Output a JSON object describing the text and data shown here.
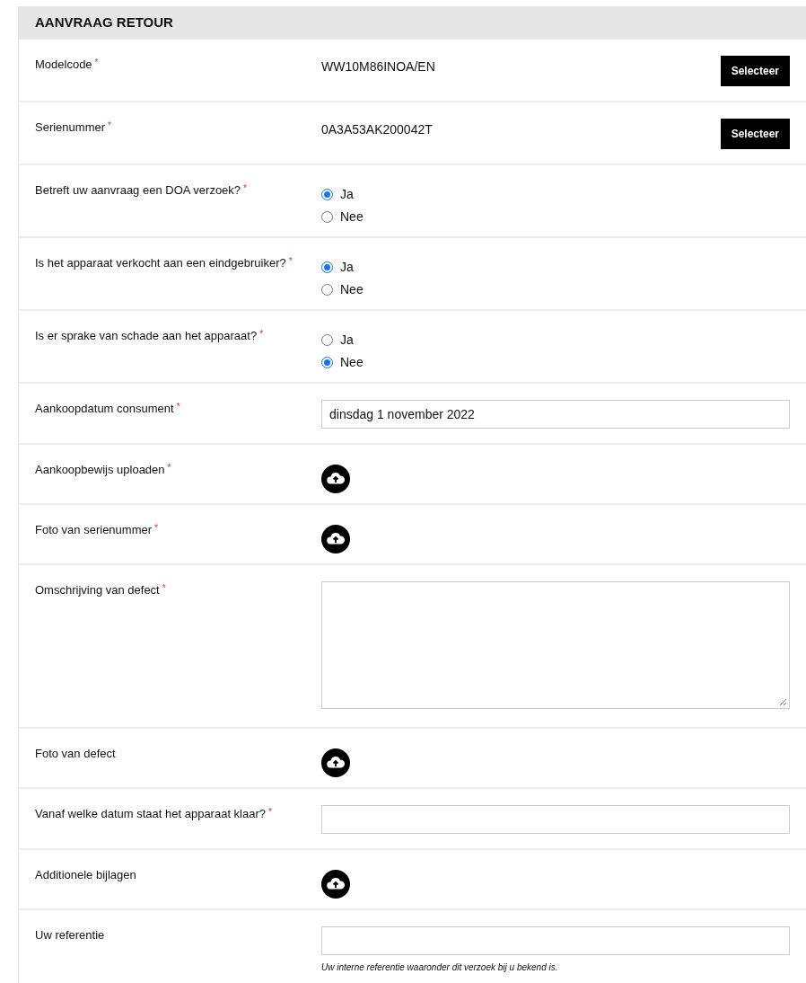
{
  "title": "AANVRAAG RETOUR",
  "rows": [
    {
      "kind": "text",
      "label": "Modelcode",
      "required_mark": "*",
      "value": "WW10M86INOA/EN",
      "button": "Selecteer"
    },
    {
      "kind": "text",
      "label": "Serienummer",
      "required_mark": "*",
      "value": "0A3A53AK200042T",
      "button": "Selecteer"
    },
    {
      "kind": "radio",
      "label": "Betreft uw aanvraag een DOA verzoek?",
      "required_mark": "*",
      "options": [
        {
          "label": "Ja",
          "selected": true
        },
        {
          "label": "Nee",
          "selected": false
        }
      ]
    },
    {
      "kind": "radio",
      "label": "Is het apparaat verkocht aan een eindgebruiker?",
      "required_mark": "*",
      "options": [
        {
          "label": "Ja",
          "selected": true
        },
        {
          "label": "Nee",
          "selected": false
        }
      ]
    },
    {
      "kind": "radio",
      "label": "Is er sprake van schade aan het apparaat?",
      "required_mark": "*",
      "options": [
        {
          "label": "Ja",
          "selected": false
        },
        {
          "label": "Nee",
          "selected": true
        }
      ]
    },
    {
      "kind": "input",
      "label": "Aankoopdatum consument",
      "required_mark": "*",
      "value": "dinsdag 1 november 2022"
    },
    {
      "kind": "upload",
      "label": "Aankoopbewijs uploaden",
      "required_mark": "*"
    },
    {
      "kind": "upload",
      "label": "Foto van serienummer",
      "required_mark": "*"
    },
    {
      "kind": "textarea",
      "label": "Omschrijving van defect",
      "required_mark": "*"
    },
    {
      "kind": "upload",
      "label": "Foto van defect"
    },
    {
      "kind": "input",
      "label": "Vanaf welke datum staat het apparaat klaar?",
      "required_mark": "*"
    },
    {
      "kind": "upload",
      "label": "Additionele bijlagen"
    },
    {
      "kind": "input",
      "label": "Uw referentie",
      "help": "Uw interne referentie waaronder dit verzoek bij u bekend is."
    }
  ]
}
